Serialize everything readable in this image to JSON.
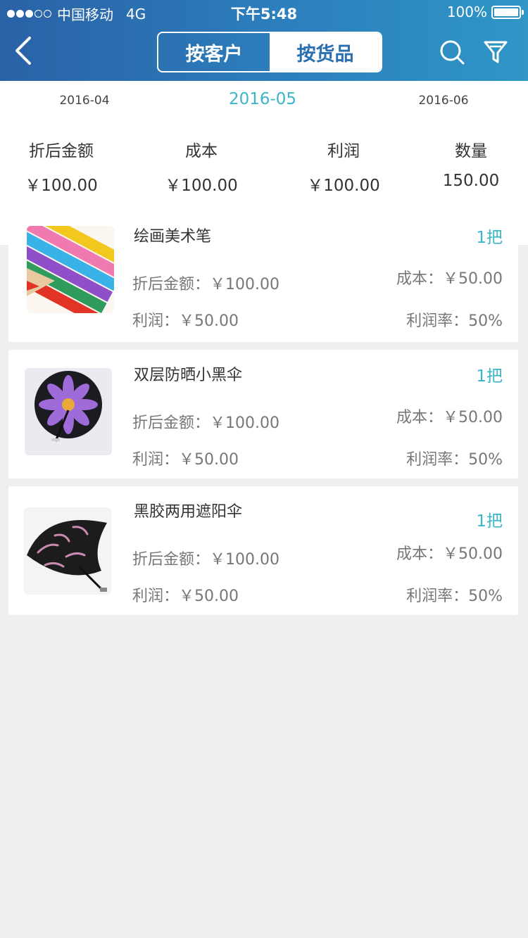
{
  "status_bar": {
    "carrier": "中国移动",
    "network": "4G",
    "time": "下午5:48",
    "battery": "100%"
  },
  "nav": {
    "back_icon": "chevron-left-icon",
    "tabs": [
      {
        "label": "按客户",
        "active": true
      },
      {
        "label": "按货品",
        "active": false
      }
    ],
    "search_icon": "search-icon",
    "filter_icon": "filter-funnel-icon"
  },
  "months": {
    "prev": "2016-04",
    "current": "2016-05",
    "next": "2016-06"
  },
  "stats": [
    {
      "label": "折后金额",
      "value": "￥100.00"
    },
    {
      "label": "成本",
      "value": "￥100.00"
    },
    {
      "label": "利润",
      "value": "￥100.00"
    },
    {
      "label": "数量",
      "value": "150.00"
    }
  ],
  "products": [
    {
      "name": "绘画美术笔",
      "qty": "1把",
      "amount": "折后金额：￥100.00",
      "cost": "成本：￥50.00",
      "profit": "利润：￥50.00",
      "rate": "利润率：50%",
      "image_icon": "colored-pencils-image"
    },
    {
      "name": "双层防晒小黑伞",
      "qty": "1把",
      "amount": "折后金额：￥100.00",
      "cost": "成本：￥50.00",
      "profit": "利润：￥50.00",
      "rate": "利润率：50%",
      "image_icon": "flower-umbrella-image"
    },
    {
      "name": "黑胶两用遮阳伞",
      "qty": "1把",
      "amount": "折后金额：￥100.00",
      "cost": "成本：￥50.00",
      "profit": "利润：￥50.00",
      "rate": "利润率：50%",
      "image_icon": "black-umbrella-image"
    }
  ],
  "colors": {
    "header_start": "#2a62a6",
    "header_end": "#2f96c6",
    "accent": "#3bb6c9",
    "background": "#efefef"
  }
}
